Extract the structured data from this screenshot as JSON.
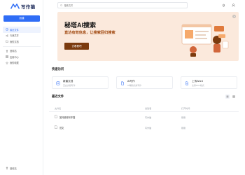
{
  "app": {
    "name": "写作猫"
  },
  "sidebar": {
    "new_button": "创建",
    "items": [
      {
        "label": "最近文件",
        "icon": "clock-icon",
        "active": true
      },
      {
        "label": "与我共享",
        "icon": "share-icon",
        "active": false
      },
      {
        "label": "我的文档",
        "icon": "folder-icon",
        "active": false
      },
      {
        "label": "回收站",
        "icon": "trash-icon",
        "active": false
      },
      {
        "label": "应用中心",
        "icon": "apps-icon",
        "active": false
      },
      {
        "label": "我的收藏",
        "icon": "star-icon",
        "active": false
      }
    ],
    "bottom_items": [
      {
        "label": "回收站",
        "icon": "trash-icon"
      }
    ]
  },
  "topbar": {
    "search_placeholder": "搜索文件"
  },
  "banner": {
    "title": "秘塔AI搜索",
    "subtitle": "直达有效信息，让搜索回归搜索",
    "button": "去看看吧",
    "bg_color": "#fbe9dc",
    "accent_color": "#7b3a0e"
  },
  "quick_access": {
    "title": "快速访问",
    "cards": [
      {
        "title": "新建文档",
        "desc": "空白文档写作",
        "icon": "add-doc-icon"
      },
      {
        "title": "AI写作",
        "desc": "AI辅助高效写作",
        "icon": "ai-doc-icon"
      },
      {
        "title": "上传Word",
        "desc": "支持docx格式",
        "icon": "upload-icon"
      }
    ]
  },
  "files": {
    "title": "最近文件",
    "columns": {
      "name": "文件名",
      "created": "创建者",
      "opened": "打开时间"
    },
    "rows": [
      {
        "name": "如何使用写作猫",
        "created": "写作猫",
        "opened": "刚刚"
      },
      {
        "name": "范文",
        "created": "写作猫",
        "opened": "刚刚"
      }
    ]
  },
  "colors": {
    "primary": "#2f6df6"
  }
}
